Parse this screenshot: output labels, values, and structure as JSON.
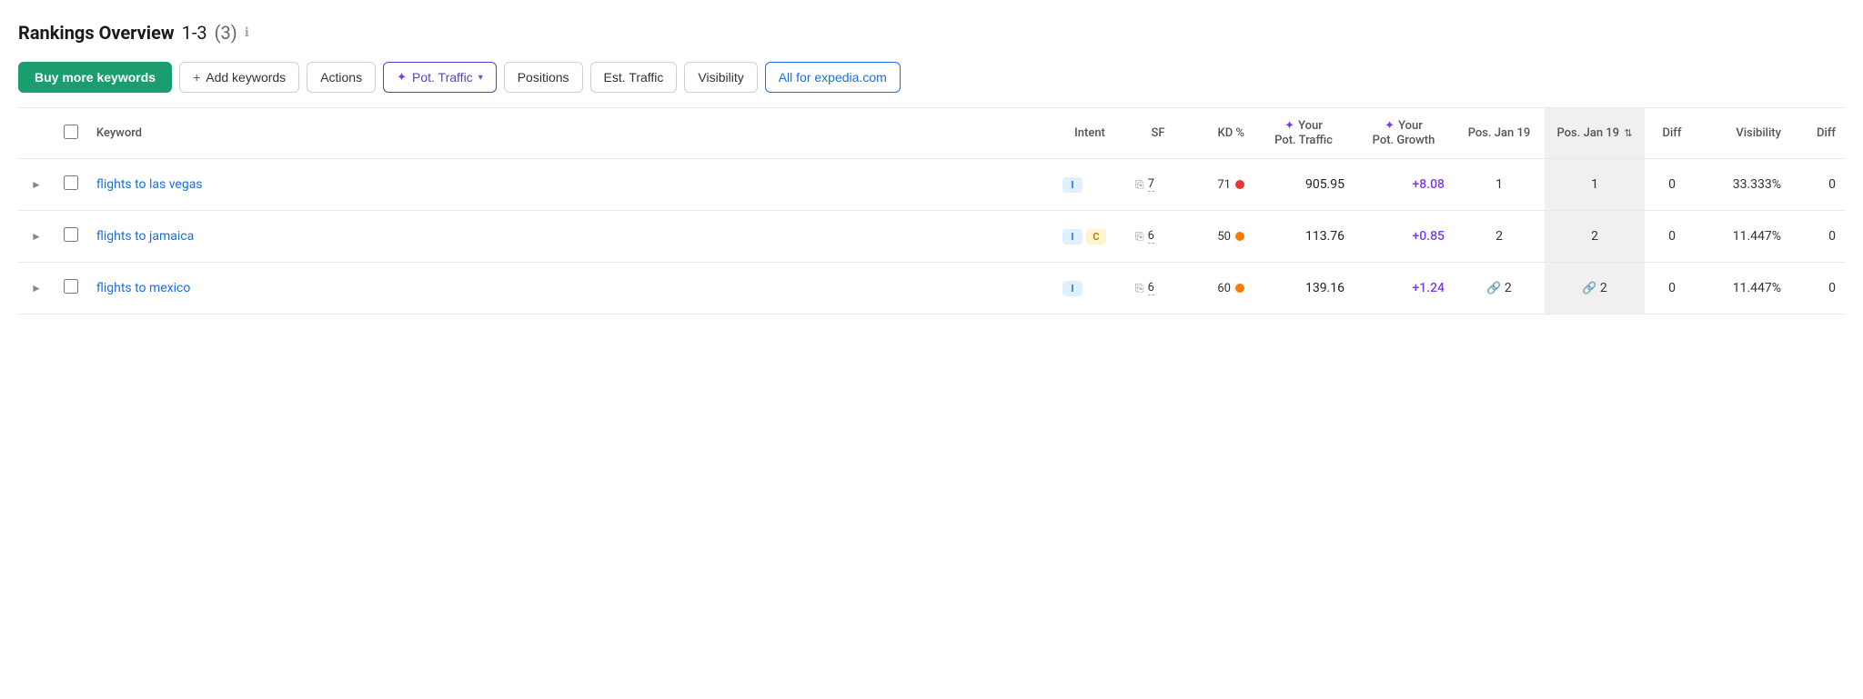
{
  "page": {
    "title": "Rankings Overview",
    "range": "1-3",
    "count": "(3)",
    "info_icon": "ℹ"
  },
  "toolbar": {
    "buy_keywords": "Buy more keywords",
    "add_keywords": "Add keywords",
    "actions": "Actions",
    "pot_traffic": "Pot. Traffic",
    "positions": "Positions",
    "est_traffic": "Est. Traffic",
    "visibility": "Visibility",
    "domain_filter": "All for expedia.com"
  },
  "table": {
    "headers": {
      "keyword": "Keyword",
      "intent": "Intent",
      "sf": "SF",
      "kd": "KD %",
      "pot_traffic_label1": "Your",
      "pot_traffic_label2": "Pot. Traffic",
      "pot_growth_label1": "Your",
      "pot_growth_label2": "Pot. Growth",
      "pos_jan19_label": "Pos. Jan 19",
      "pos_jan19_sorted_label": "Pos. Jan 19",
      "diff": "Diff",
      "visibility": "Visibility",
      "diff2": "Diff"
    },
    "rows": [
      {
        "keyword": "flights to las vegas",
        "intent": [
          "I"
        ],
        "sf_icon": true,
        "sf_num": "7",
        "kd": "71",
        "kd_color": "red",
        "pot_traffic": "905.95",
        "pot_growth": "+8.08",
        "pos1": "1",
        "pos1_link": false,
        "pos2": "1",
        "pos2_link": false,
        "diff": "0",
        "visibility": "33.333%",
        "diff2": "0"
      },
      {
        "keyword": "flights to jamaica",
        "intent": [
          "I",
          "C"
        ],
        "sf_icon": true,
        "sf_num": "6",
        "kd": "50",
        "kd_color": "orange",
        "pot_traffic": "113.76",
        "pot_growth": "+0.85",
        "pos1": "2",
        "pos1_link": false,
        "pos2": "2",
        "pos2_link": false,
        "diff": "0",
        "visibility": "11.447%",
        "diff2": "0"
      },
      {
        "keyword": "flights to mexico",
        "intent": [
          "I"
        ],
        "sf_icon": true,
        "sf_num": "6",
        "kd": "60",
        "kd_color": "orange",
        "pot_traffic": "139.16",
        "pot_growth": "+1.24",
        "pos1": "2",
        "pos1_link": true,
        "pos2": "2",
        "pos2_link": true,
        "diff": "0",
        "visibility": "11.447%",
        "diff2": "0"
      }
    ]
  }
}
